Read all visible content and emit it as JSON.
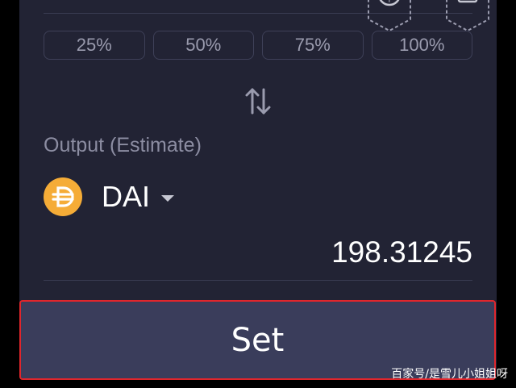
{
  "percent_buttons": [
    "25%",
    "50%",
    "75%",
    "100%"
  ],
  "output": {
    "label": "Output (Estimate)",
    "token": "DAI",
    "token_icon": "dai-logo-icon",
    "amount": "198.31245"
  },
  "set_button": "Set",
  "watermark": "百家号/是雪儿小姐姐呀",
  "colors": {
    "panel": "#222334",
    "button": "#3a3d5b",
    "highlight": "#e0262c",
    "dai": "#f5ac37"
  }
}
